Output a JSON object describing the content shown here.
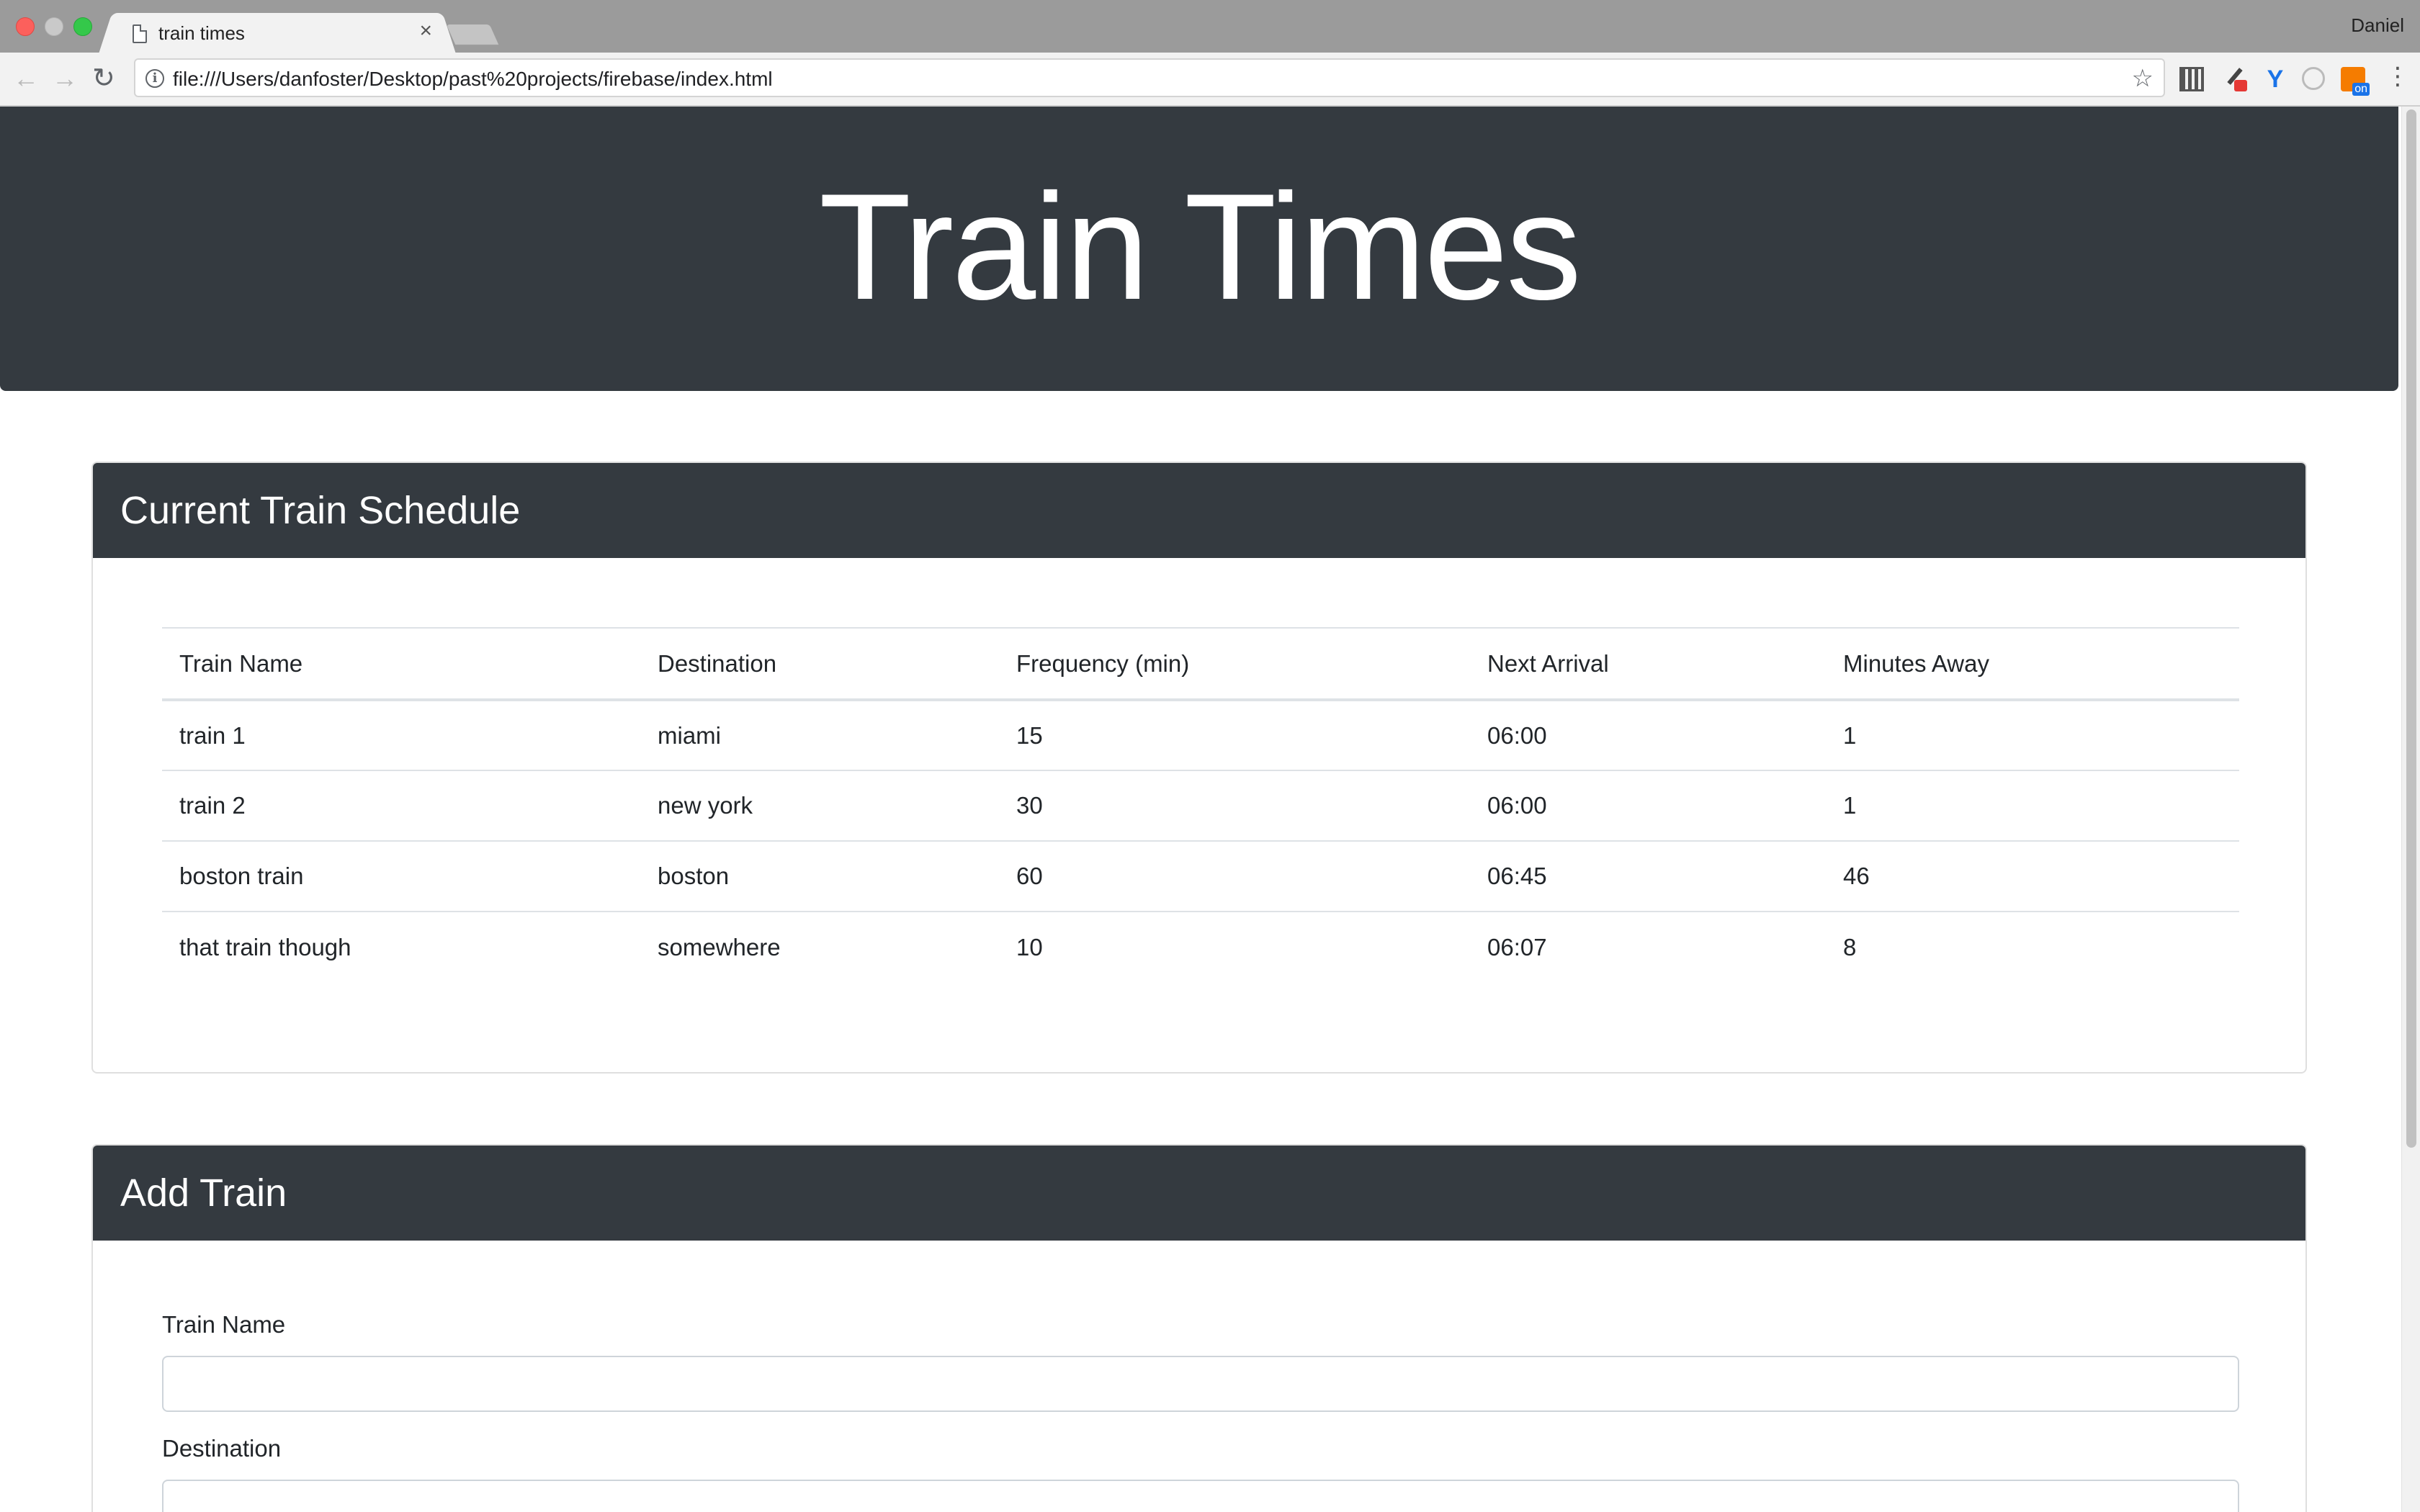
{
  "browser": {
    "tab_title": "train times",
    "tab_close": "×",
    "profile_name": "Daniel",
    "url": "file:///Users/danfoster/Desktop/past%20projects/firebase/index.html",
    "back_glyph": "←",
    "forward_glyph": "→",
    "reload_glyph": "↻",
    "info_glyph": "i",
    "star_glyph": "☆",
    "ext3_glyph": "Y",
    "menu_glyph": "⋮"
  },
  "page": {
    "title": "Train Times"
  },
  "schedule": {
    "heading": "Current Train Schedule",
    "columns": [
      "Train Name",
      "Destination",
      "Frequency (min)",
      "Next Arrival",
      "Minutes Away"
    ],
    "rows": [
      [
        "train 1",
        "miami",
        "15",
        "06:00",
        "1"
      ],
      [
        "train 2",
        "new york",
        "30",
        "06:00",
        "1"
      ],
      [
        "boston train",
        "boston",
        "60",
        "06:45",
        "46"
      ],
      [
        "that train though",
        "somewhere",
        "10",
        "06:07",
        "8"
      ]
    ]
  },
  "add_train": {
    "heading": "Add Train",
    "train_name_label": "Train Name",
    "train_name_value": "",
    "destination_label": "Destination",
    "destination_value": ""
  },
  "colors": {
    "header_bg": "#343a40",
    "header_text": "#ffffff",
    "chrome_bg": "#9b9b9b"
  }
}
